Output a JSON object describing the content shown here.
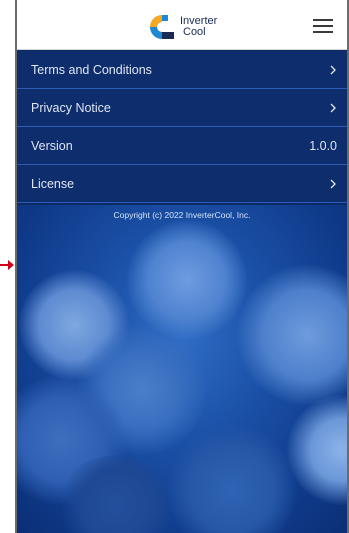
{
  "header": {
    "logo": {
      "line1": "Inverter",
      "line2": "Cool",
      "colors": [
        "#f5a623",
        "#1e88d4",
        "#1a2a55"
      ]
    },
    "menu_icon": "hamburger-menu-icon"
  },
  "menu": {
    "items": [
      {
        "label": "Terms and Conditions",
        "icon": "chevron-right-icon",
        "value": ""
      },
      {
        "label": "Privacy Notice",
        "icon": "chevron-right-icon",
        "value": ""
      },
      {
        "label": "Version",
        "icon": "",
        "value": "1.0.0"
      },
      {
        "label": "License",
        "icon": "chevron-right-icon",
        "value": ""
      }
    ]
  },
  "footer": {
    "copyright": "Copyright (c) 2022 InverterCool, Inc."
  },
  "colors": {
    "accent_pointer": "#d0021b",
    "menu_bg": "#0e2d6c",
    "divider": "#2a5db3"
  }
}
